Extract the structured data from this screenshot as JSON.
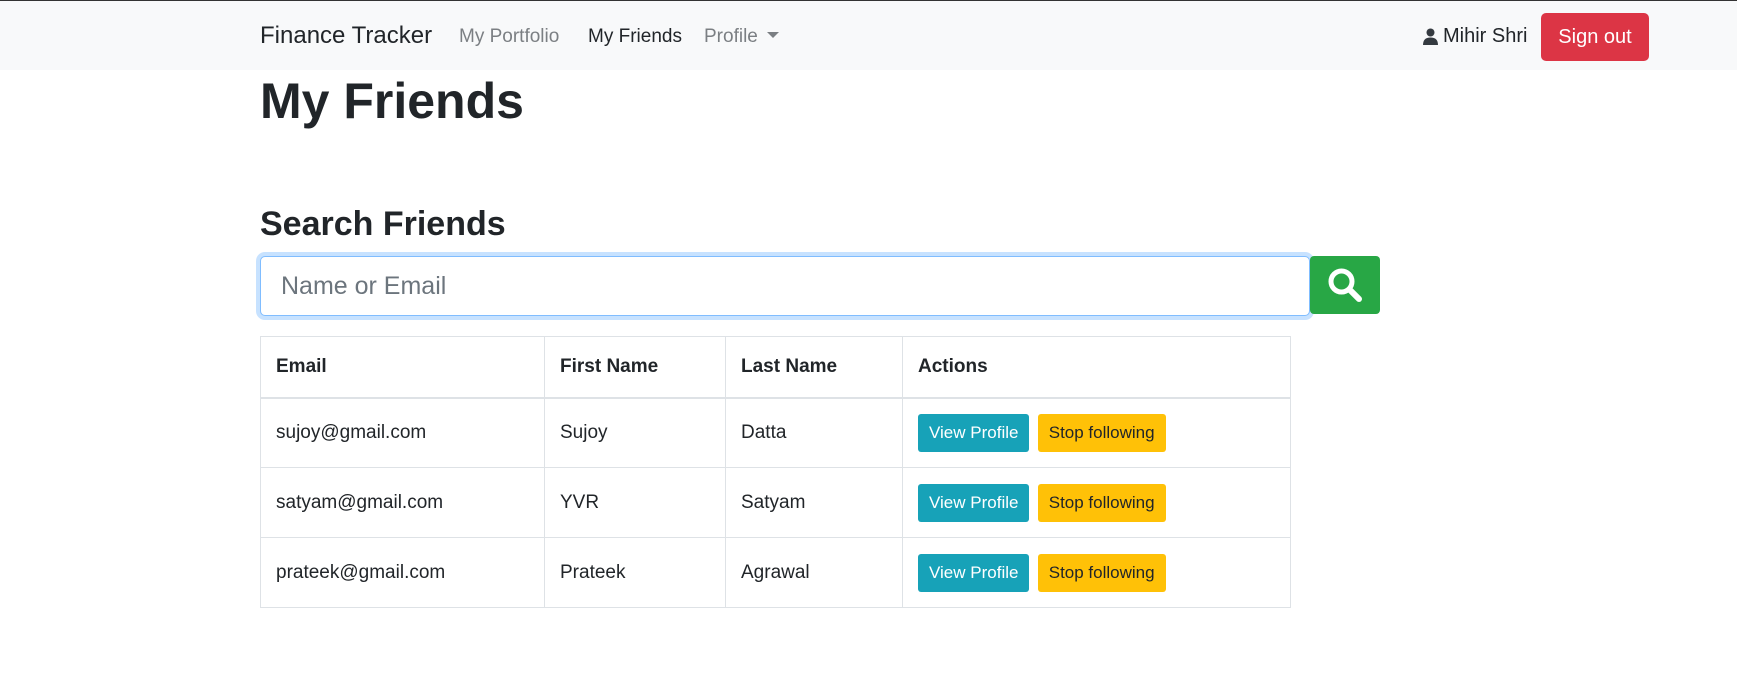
{
  "navbar": {
    "brand": "Finance Tracker",
    "links": [
      "My Portfolio",
      "My Friends",
      "Profile"
    ],
    "user_name": "Mihir Shri",
    "sign_out_label": "Sign out"
  },
  "page": {
    "title": "My Friends",
    "search_title": "Search Friends",
    "search_placeholder": "Name or Email"
  },
  "table": {
    "headers": [
      "Email",
      "First Name",
      "Last Name",
      "Actions"
    ],
    "rows": [
      {
        "email": "sujoy@gmail.com",
        "first_name": "Sujoy",
        "last_name": "Datta",
        "view_label": "View Profile",
        "stop_label": "Stop following"
      },
      {
        "email": "satyam@gmail.com",
        "first_name": "YVR",
        "last_name": "Satyam",
        "view_label": "View Profile",
        "stop_label": "Stop following"
      },
      {
        "email": "prateek@gmail.com",
        "first_name": "Prateek",
        "last_name": "Agrawal",
        "view_label": "View Profile",
        "stop_label": "Stop following"
      }
    ]
  },
  "icons": {
    "user": "user-icon",
    "search": "search-icon",
    "dropdown": "chevron-down-icon"
  },
  "colors": {
    "danger": "#dc3545",
    "success": "#28a745",
    "info": "#17a2b8",
    "warning": "#ffc107",
    "navbar_bg": "#f8f9fa"
  }
}
